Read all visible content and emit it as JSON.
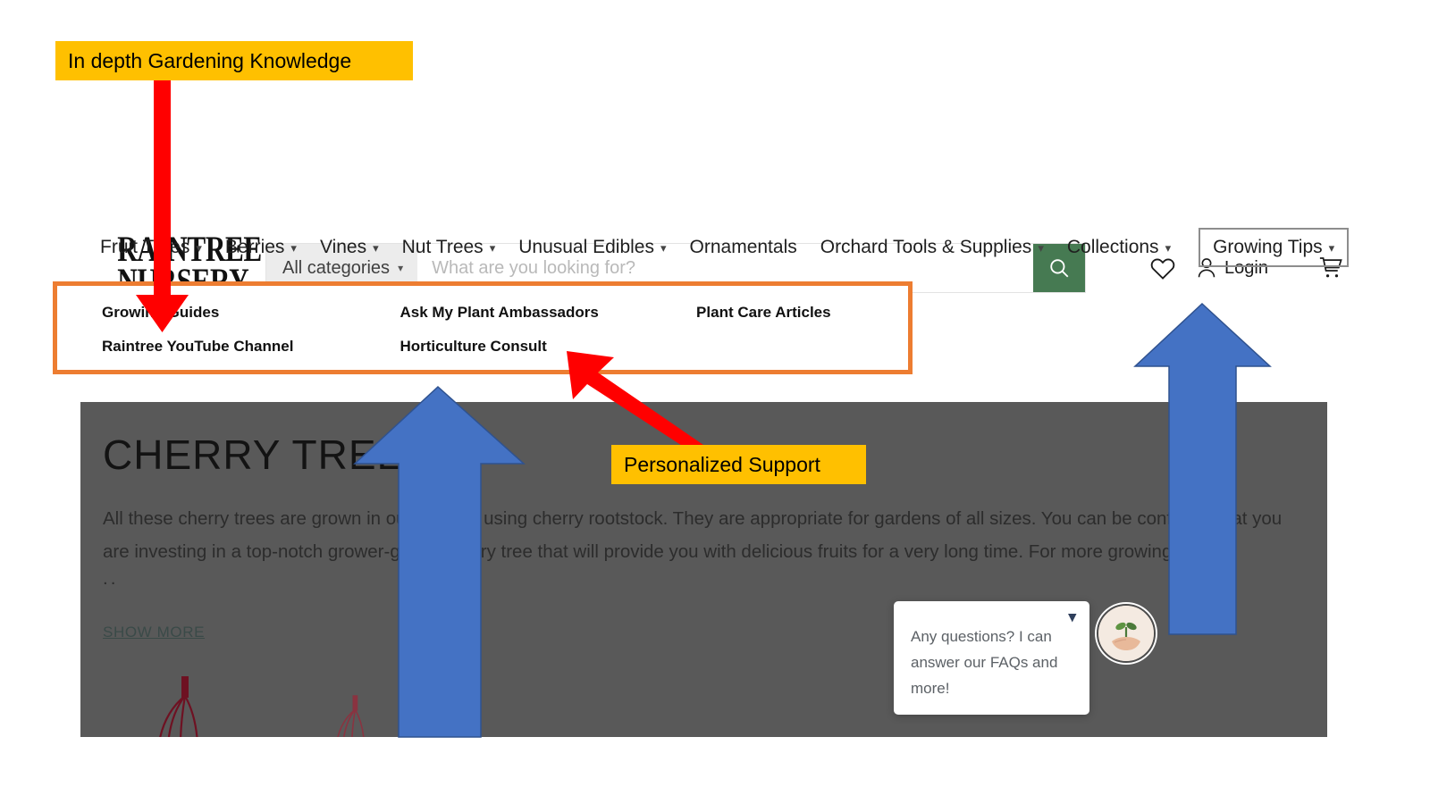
{
  "annotations": {
    "knowledge": {
      "label": "In depth Gardening Knowledge",
      "box_color": "#FFC000",
      "arrow_color": "#FF0000"
    },
    "support": {
      "label": "Personalized Support",
      "box_color": "#FFC000",
      "arrow_color": "#FF0000"
    },
    "highlight_color": "#ED7D31",
    "blue_arrow_color": "#4472C4"
  },
  "header": {
    "logo": {
      "line1": "RAINTREE",
      "line2": "NURSERY"
    },
    "search": {
      "category_label": "All categories",
      "category_chevron": "chevron-down-icon",
      "placeholder": "What are you looking for?",
      "value": "",
      "button_icon": "search-icon",
      "button_color": "#467A52"
    },
    "actions": [
      {
        "name": "wishlist",
        "icon": "heart-icon",
        "label": ""
      },
      {
        "name": "account",
        "icon": "user-icon",
        "label": "Login"
      },
      {
        "name": "cart",
        "icon": "cart-icon",
        "label": ""
      }
    ]
  },
  "nav": {
    "items": [
      {
        "label": "Fruit Trees",
        "has_dropdown": true,
        "active": false
      },
      {
        "label": "Berries",
        "has_dropdown": true,
        "active": false
      },
      {
        "label": "Vines",
        "has_dropdown": true,
        "active": false
      },
      {
        "label": "Nut Trees",
        "has_dropdown": true,
        "active": false
      },
      {
        "label": "Unusual Edibles",
        "has_dropdown": true,
        "active": false
      },
      {
        "label": "Ornamentals",
        "has_dropdown": false,
        "active": false
      },
      {
        "label": "Orchard Tools & Supplies",
        "has_dropdown": true,
        "active": false
      },
      {
        "label": "Collections",
        "has_dropdown": true,
        "active": false
      },
      {
        "label": "Growing Tips",
        "has_dropdown": true,
        "active": true
      }
    ]
  },
  "dropdown": {
    "rows": [
      [
        "Growing Guides",
        "Ask My Plant Ambassadors",
        "Plant Care Articles"
      ],
      [
        "Raintree YouTube Channel",
        "Horticulture Consult",
        ""
      ]
    ]
  },
  "hero": {
    "title": "CHERRY TREES",
    "body": "All these cherry trees are grown in our nursery using cherry rootstock. They are appropriate for gardens of all sizes. You can be confident that you are investing in a top-notch grower-grown cherry tree that will provide you with delicious fruits for a very long time. For more growing info.",
    "ellipsis": "..",
    "show_more": "SHOW MORE",
    "background_color": "#595959"
  },
  "chat": {
    "message": "Any questions? I can answer our FAQs and more!",
    "collapse_icon": "chevron-down-icon",
    "avatar_icon": "hand-holding-seedling-icon"
  }
}
